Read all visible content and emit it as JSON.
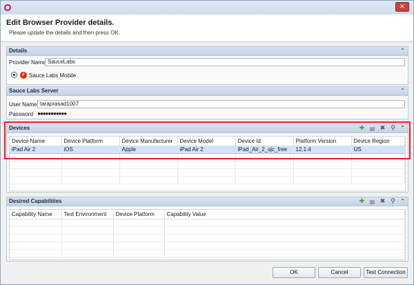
{
  "dialog": {
    "title": "Edit Browser Provider details.",
    "subtitle": "Please update the details and then press OK.",
    "close_glyph": "×"
  },
  "details": {
    "section_title": "Details",
    "provider_name_label": "Provider Name",
    "provider_name_value": "SauceLabs",
    "radio_label": "Sauce Labs Mobile"
  },
  "server": {
    "section_title": "Sauce Labs Server",
    "username_label": "User Name",
    "username_value": "taraprasad1007",
    "password_label": "Password",
    "password_value": "●●●●●●●●●●●"
  },
  "devices": {
    "section_title": "Devices",
    "columns": [
      "Device Name",
      "Device Platform",
      "Device Manufacturer",
      "Device Model",
      "Device Id",
      "Platform Version",
      "Device Region"
    ],
    "rows": [
      [
        "iPad Air 2",
        "iOS",
        "Apple",
        "iPad Air 2",
        "iPad_Air_2_sjc_free",
        "12.1.4",
        "US"
      ]
    ]
  },
  "capabilities": {
    "section_title": "Desired Capabilities",
    "columns": [
      "Capability Name",
      "Test Environment",
      "Device Platform",
      "Capability Value"
    ]
  },
  "toolbar_icons": [
    "add-icon",
    "edit-icon",
    "delete-icon",
    "search-icon",
    "collapse-icon"
  ],
  "colors": {
    "highlight": "#e32222",
    "section_header": "#c4d3e4",
    "selected_row": "#cfe4f8"
  },
  "footer": {
    "ok_label": "OK",
    "cancel_label": "Cancel",
    "test_label": "Test Connection"
  }
}
